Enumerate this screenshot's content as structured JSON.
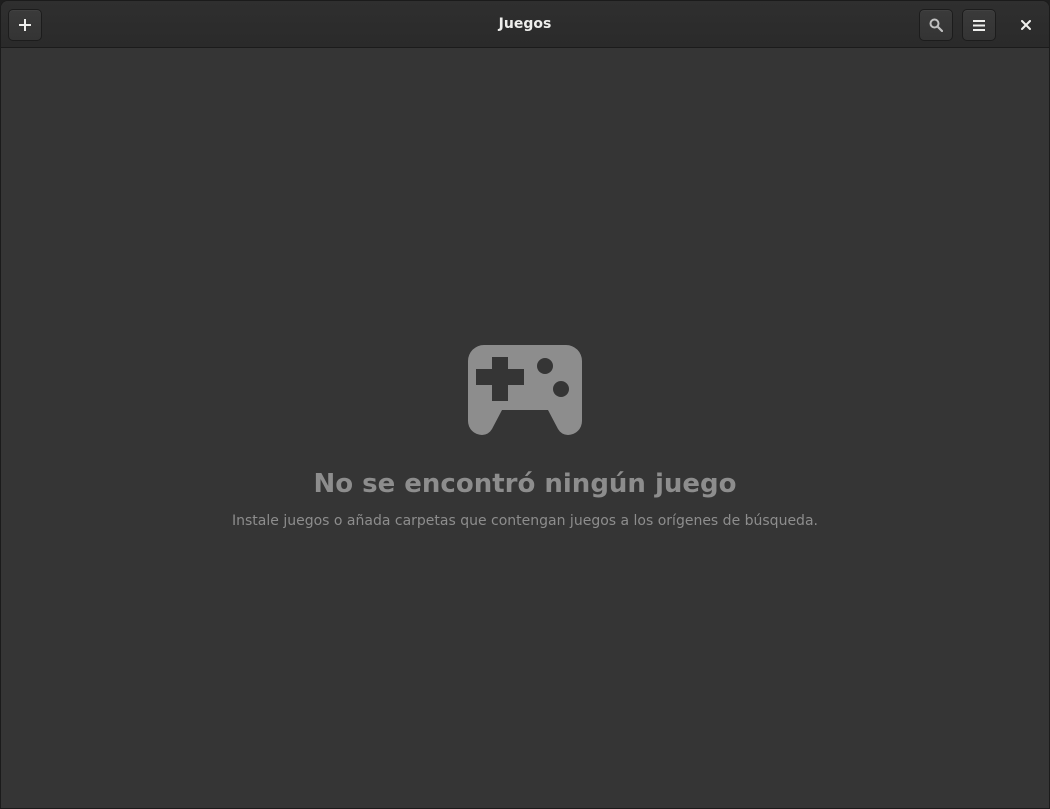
{
  "window": {
    "title": "Juegos"
  },
  "headerbar": {
    "add_icon": "plus-icon",
    "search_icon": "search-icon",
    "menu_icon": "hamburger-menu-icon",
    "close_icon": "close-icon"
  },
  "empty_state": {
    "icon": "gamepad-icon",
    "title": "No se encontró ningún juego",
    "subtitle": "Instale juegos o añada carpetas que contengan juegos a los orígenes de búsqueda."
  },
  "colors": {
    "background": "#353535",
    "headerbar": "#2d2d2d",
    "foreground": "#eeeeec",
    "dim_text": "#8d8d8d"
  }
}
